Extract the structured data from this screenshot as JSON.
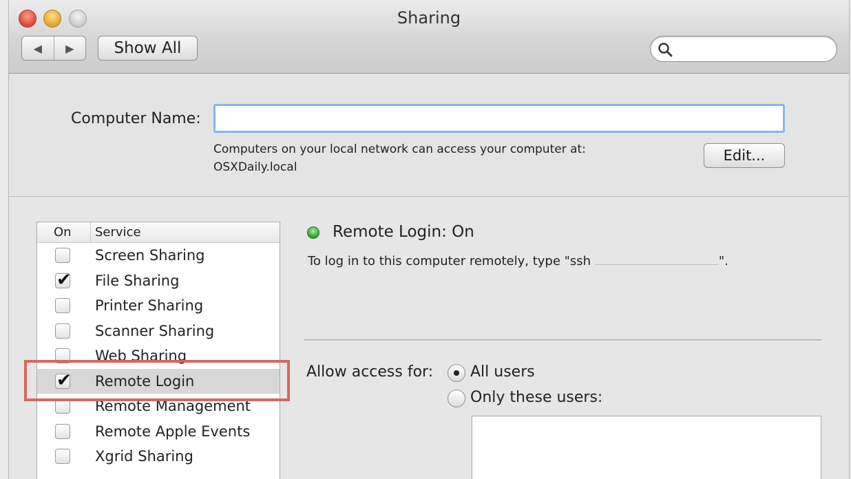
{
  "window": {
    "title": "Sharing"
  },
  "toolbar": {
    "back_icon": "◀",
    "forward_icon": "▶",
    "show_all_label": "Show All",
    "search_placeholder": ""
  },
  "computer_name": {
    "label": "Computer Name:",
    "value": "",
    "help_line1": "Computers on your local network can access your computer at:",
    "help_line2": "OSXDaily.local",
    "edit_label": "Edit..."
  },
  "services": {
    "header_on": "On",
    "header_service": "Service",
    "items": [
      {
        "label": "Screen Sharing",
        "checked": false
      },
      {
        "label": "File Sharing",
        "checked": true
      },
      {
        "label": "Printer Sharing",
        "checked": false
      },
      {
        "label": "Scanner Sharing",
        "checked": false
      },
      {
        "label": "Web Sharing",
        "checked": false
      },
      {
        "label": "Remote Login",
        "checked": true,
        "selected": true
      },
      {
        "label": "Remote Management",
        "checked": false
      },
      {
        "label": "Remote Apple Events",
        "checked": false
      },
      {
        "label": "Xgrid Sharing",
        "checked": false
      }
    ]
  },
  "detail": {
    "status_text": "Remote Login: On",
    "help_prefix": "To log in to this computer remotely, type \"ssh",
    "help_suffix": "\".",
    "access_label": "Allow access for:",
    "option_all": "All users",
    "option_only": "Only these users:",
    "selected_option": "All users"
  },
  "colors": {
    "status_on": "#2f9a2c",
    "highlight": "#d9665c",
    "field_focus": "#8ab6e8"
  }
}
